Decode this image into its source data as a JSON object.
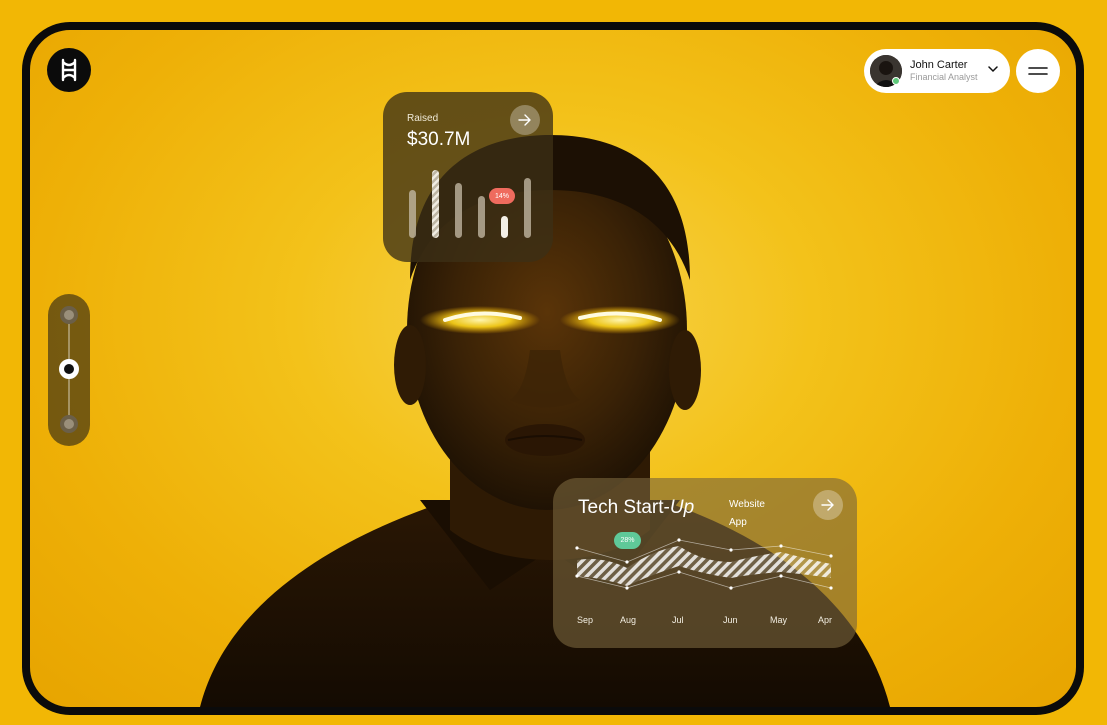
{
  "profile": {
    "name": "John Carter",
    "role": "Financial Analyst"
  },
  "raised_card": {
    "label": "Raised",
    "value": "$30.7M",
    "badge": "14%",
    "bars": [
      {
        "value": 48,
        "style": "plain"
      },
      {
        "value": 68,
        "style": "striped"
      },
      {
        "value": 55,
        "style": "plain"
      },
      {
        "value": 42,
        "style": "plain"
      },
      {
        "value": 22,
        "style": "highlight"
      },
      {
        "value": 60,
        "style": "plain"
      }
    ]
  },
  "tech_card": {
    "title_main": "Tech Start-",
    "title_italic": "Up",
    "legend": [
      "Website",
      "App"
    ],
    "badge": "28%",
    "months": [
      "Sep",
      "Aug",
      "Jul",
      "Jun",
      "May",
      "Apr"
    ]
  },
  "slider": {
    "stops": 3,
    "active_index": 1
  },
  "colors": {
    "background": "#f2b705",
    "frame": "#0b0b0b",
    "red_badge": "#ef6b5e",
    "green_badge": "#5fc999",
    "online": "#5ec97a"
  }
}
